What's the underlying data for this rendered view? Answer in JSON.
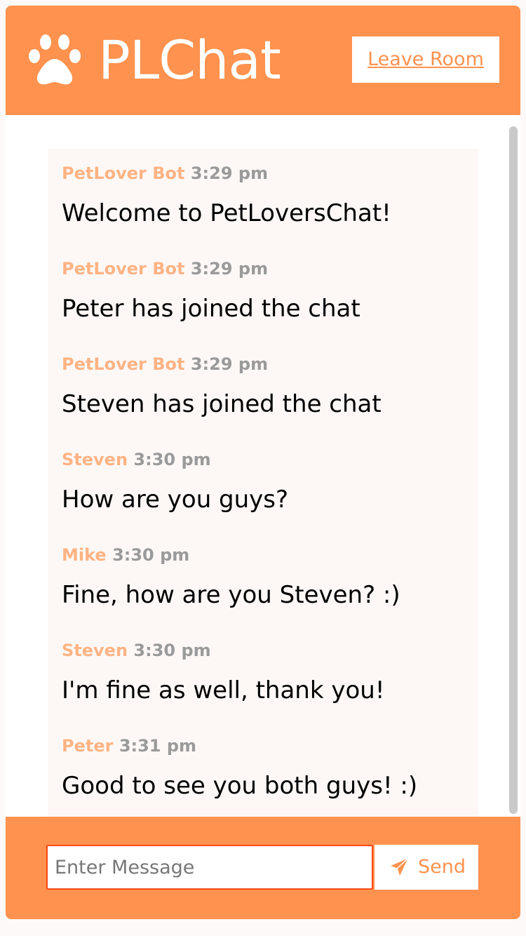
{
  "header": {
    "logo_text": "PLChat",
    "logo_icon": "paw-icon",
    "leave_label": "Leave Room"
  },
  "messages": [
    {
      "author": "PetLover Bot",
      "time": "3:29 pm",
      "text": "Welcome to PetLoversChat!"
    },
    {
      "author": "PetLover Bot",
      "time": "3:29 pm",
      "text": "Peter has joined the chat"
    },
    {
      "author": "PetLover Bot",
      "time": "3:29 pm",
      "text": "Steven has joined the chat"
    },
    {
      "author": "Steven",
      "time": "3:30 pm",
      "text": "How are you guys?"
    },
    {
      "author": "Mike",
      "time": "3:30 pm",
      "text": "Fine, how are you Steven? :)"
    },
    {
      "author": "Steven",
      "time": "3:30 pm",
      "text": "I'm fine as well, thank you!"
    },
    {
      "author": "Peter",
      "time": "3:31 pm",
      "text": "Good to see you both guys! :)"
    }
  ],
  "composer": {
    "placeholder": "Enter Message",
    "value": "",
    "send_label": "Send",
    "send_icon": "paper-plane-icon"
  },
  "colors": {
    "accent": "#ff924e",
    "author": "#ffb384",
    "time": "#9a9a9a",
    "message_background": "#fdf8f6",
    "input_border": "#ff4a16"
  }
}
